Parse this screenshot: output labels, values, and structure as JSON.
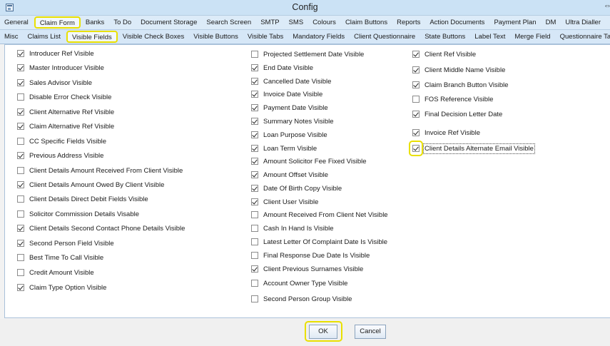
{
  "window": {
    "title": "Config",
    "restore_glyph": "⇔"
  },
  "top_tabs": [
    "General",
    "Claim Form",
    "Banks",
    "To Do",
    "Document Storage",
    "Search Screen",
    "SMTP",
    "SMS",
    "Colours",
    "Claim Buttons",
    "Reports",
    "Action Documents",
    "Payment Plan",
    "DM",
    "Ultra Dialler",
    "Ba"
  ],
  "top_tabs_active": "Claim Form",
  "sub_tabs": [
    "Misc",
    "Claims List",
    "Visible Fields",
    "Visible Check Boxes",
    "Visible Buttons",
    "Visible Tabs",
    "Mandatory Fields",
    "Client Questionnaire",
    "State Buttons",
    "Label Text",
    "Merge Field",
    "Questionnaire Tabs"
  ],
  "sub_tabs_active": "Visible Fields",
  "columns": [
    {
      "items": [
        {
          "label": "Introducer Ref Visible",
          "checked": true
        },
        {
          "label": "Master Introducer Visible",
          "checked": true
        },
        {
          "label": "Sales Advisor Visible",
          "checked": true
        },
        {
          "label": "Disable Error Check Visible",
          "checked": false
        },
        {
          "label": "Client Alternative Ref Visible",
          "checked": true
        },
        {
          "label": "Claim Alternative Ref Visible",
          "checked": true
        },
        {
          "label": "CC Specific Fields Visible",
          "checked": false
        },
        {
          "label": "Previous Address Visible",
          "checked": true
        },
        {
          "label": "Client Details Amount Received From Client Visible",
          "checked": false
        },
        {
          "label": "Client Details Amount Owed By Client Visible",
          "checked": true
        },
        {
          "label": "Client Details Direct Debit Fields Visible",
          "checked": false
        },
        {
          "label": "Solicitor Commission Details Visable",
          "checked": false
        },
        {
          "label": "Client Details Second Contact Phone Details Visible",
          "checked": true
        },
        {
          "label": "Second Person Field Visible",
          "checked": true
        },
        {
          "label": "Best Time To Call Visible",
          "checked": false
        },
        {
          "label": "Credit Amount Visible",
          "checked": false
        },
        {
          "label": "Claim Type Option Visible",
          "checked": true
        }
      ]
    },
    {
      "items": [
        {
          "label": "Projected Settlement Date Visible",
          "checked": false
        },
        {
          "label": "End Date Visible",
          "checked": true
        },
        {
          "label": "Cancelled Date Visible",
          "checked": true
        },
        {
          "label": " Invoice Date Visible",
          "checked": true
        },
        {
          "label": "Payment Date Visible",
          "checked": true
        },
        {
          "label": "Summary Notes Visible",
          "checked": true
        },
        {
          "label": "Loan Purpose Visible",
          "checked": true
        },
        {
          "label": "Loan Term Visible",
          "checked": true
        },
        {
          "label": "Amount Solicitor Fee Fixed Visible",
          "checked": true
        },
        {
          "label": "Amount Offset Visible",
          "checked": true
        },
        {
          "label": "Date Of Birth Copy Visible",
          "checked": true
        },
        {
          "label": "Client User Visible",
          "checked": true
        },
        {
          "label": "Amount Received From Client Net Visible",
          "checked": false
        },
        {
          "label": "Cash In Hand Is Visible",
          "checked": false
        },
        {
          "label": "Latest Letter Of Complaint Date Is Visible",
          "checked": false
        },
        {
          "label": "Final Response Due Date Is Visible",
          "checked": false
        },
        {
          "label": "Client Previous Surnames Visible",
          "checked": true
        },
        {
          "label": "Account Owner Type Visible",
          "checked": false
        },
        {
          "label": "Second Person Group Visible",
          "checked": false
        }
      ]
    },
    {
      "items": [
        {
          "label": "Client Ref Visible",
          "checked": true
        },
        {
          "label": "Client Middle Name Visible",
          "checked": true
        },
        {
          "label": "Claim Branch Button Visible",
          "checked": true
        },
        {
          "label": "FOS Reference Visible",
          "checked": false
        },
        {
          "label": "Final Decision Letter Date",
          "checked": true
        },
        {
          "label": "Invoice Ref Visible",
          "checked": true
        },
        {
          "label": "Client Details Alternate Email Visible",
          "checked": true
        }
      ]
    }
  ],
  "footer": {
    "ok_label": "OK",
    "cancel_label": "Cancel"
  },
  "colors": {
    "highlight": "#e9e000",
    "tab_bar": "#dcebf8",
    "title_bar": "#cbe2f5"
  }
}
